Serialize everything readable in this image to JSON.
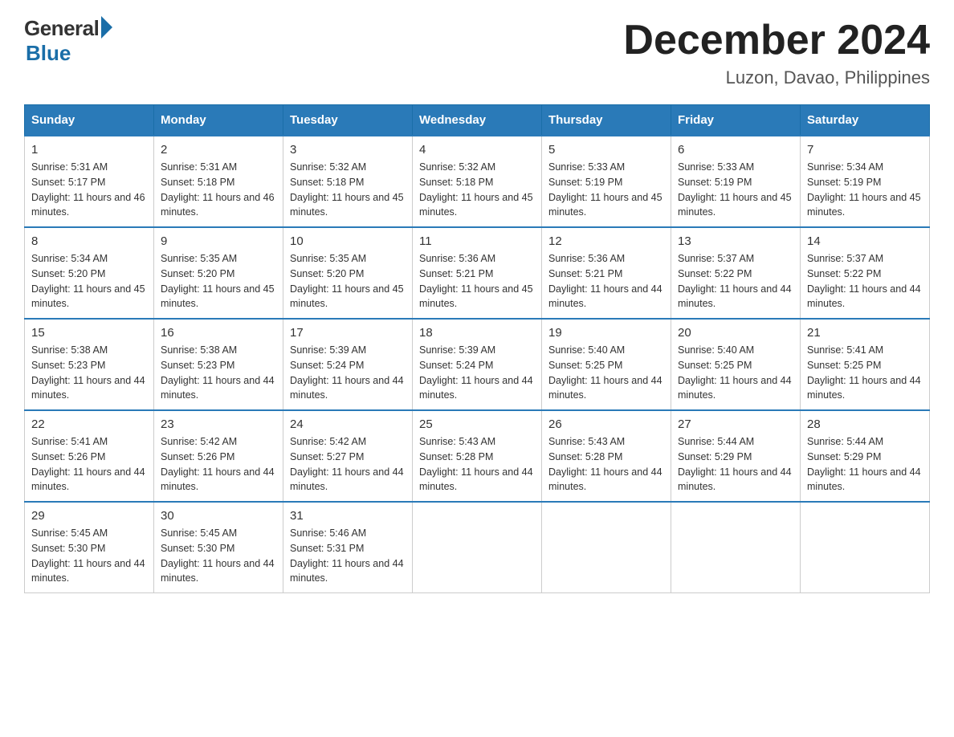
{
  "header": {
    "logo_general": "General",
    "logo_blue": "Blue",
    "main_title": "December 2024",
    "subtitle": "Luzon, Davao, Philippines"
  },
  "calendar": {
    "days_of_week": [
      "Sunday",
      "Monday",
      "Tuesday",
      "Wednesday",
      "Thursday",
      "Friday",
      "Saturday"
    ],
    "weeks": [
      [
        {
          "day": "1",
          "sunrise": "5:31 AM",
          "sunset": "5:17 PM",
          "daylight": "11 hours and 46 minutes."
        },
        {
          "day": "2",
          "sunrise": "5:31 AM",
          "sunset": "5:18 PM",
          "daylight": "11 hours and 46 minutes."
        },
        {
          "day": "3",
          "sunrise": "5:32 AM",
          "sunset": "5:18 PM",
          "daylight": "11 hours and 45 minutes."
        },
        {
          "day": "4",
          "sunrise": "5:32 AM",
          "sunset": "5:18 PM",
          "daylight": "11 hours and 45 minutes."
        },
        {
          "day": "5",
          "sunrise": "5:33 AM",
          "sunset": "5:19 PM",
          "daylight": "11 hours and 45 minutes."
        },
        {
          "day": "6",
          "sunrise": "5:33 AM",
          "sunset": "5:19 PM",
          "daylight": "11 hours and 45 minutes."
        },
        {
          "day": "7",
          "sunrise": "5:34 AM",
          "sunset": "5:19 PM",
          "daylight": "11 hours and 45 minutes."
        }
      ],
      [
        {
          "day": "8",
          "sunrise": "5:34 AM",
          "sunset": "5:20 PM",
          "daylight": "11 hours and 45 minutes."
        },
        {
          "day": "9",
          "sunrise": "5:35 AM",
          "sunset": "5:20 PM",
          "daylight": "11 hours and 45 minutes."
        },
        {
          "day": "10",
          "sunrise": "5:35 AM",
          "sunset": "5:20 PM",
          "daylight": "11 hours and 45 minutes."
        },
        {
          "day": "11",
          "sunrise": "5:36 AM",
          "sunset": "5:21 PM",
          "daylight": "11 hours and 45 minutes."
        },
        {
          "day": "12",
          "sunrise": "5:36 AM",
          "sunset": "5:21 PM",
          "daylight": "11 hours and 44 minutes."
        },
        {
          "day": "13",
          "sunrise": "5:37 AM",
          "sunset": "5:22 PM",
          "daylight": "11 hours and 44 minutes."
        },
        {
          "day": "14",
          "sunrise": "5:37 AM",
          "sunset": "5:22 PM",
          "daylight": "11 hours and 44 minutes."
        }
      ],
      [
        {
          "day": "15",
          "sunrise": "5:38 AM",
          "sunset": "5:23 PM",
          "daylight": "11 hours and 44 minutes."
        },
        {
          "day": "16",
          "sunrise": "5:38 AM",
          "sunset": "5:23 PM",
          "daylight": "11 hours and 44 minutes."
        },
        {
          "day": "17",
          "sunrise": "5:39 AM",
          "sunset": "5:24 PM",
          "daylight": "11 hours and 44 minutes."
        },
        {
          "day": "18",
          "sunrise": "5:39 AM",
          "sunset": "5:24 PM",
          "daylight": "11 hours and 44 minutes."
        },
        {
          "day": "19",
          "sunrise": "5:40 AM",
          "sunset": "5:25 PM",
          "daylight": "11 hours and 44 minutes."
        },
        {
          "day": "20",
          "sunrise": "5:40 AM",
          "sunset": "5:25 PM",
          "daylight": "11 hours and 44 minutes."
        },
        {
          "day": "21",
          "sunrise": "5:41 AM",
          "sunset": "5:25 PM",
          "daylight": "11 hours and 44 minutes."
        }
      ],
      [
        {
          "day": "22",
          "sunrise": "5:41 AM",
          "sunset": "5:26 PM",
          "daylight": "11 hours and 44 minutes."
        },
        {
          "day": "23",
          "sunrise": "5:42 AM",
          "sunset": "5:26 PM",
          "daylight": "11 hours and 44 minutes."
        },
        {
          "day": "24",
          "sunrise": "5:42 AM",
          "sunset": "5:27 PM",
          "daylight": "11 hours and 44 minutes."
        },
        {
          "day": "25",
          "sunrise": "5:43 AM",
          "sunset": "5:28 PM",
          "daylight": "11 hours and 44 minutes."
        },
        {
          "day": "26",
          "sunrise": "5:43 AM",
          "sunset": "5:28 PM",
          "daylight": "11 hours and 44 minutes."
        },
        {
          "day": "27",
          "sunrise": "5:44 AM",
          "sunset": "5:29 PM",
          "daylight": "11 hours and 44 minutes."
        },
        {
          "day": "28",
          "sunrise": "5:44 AM",
          "sunset": "5:29 PM",
          "daylight": "11 hours and 44 minutes."
        }
      ],
      [
        {
          "day": "29",
          "sunrise": "5:45 AM",
          "sunset": "5:30 PM",
          "daylight": "11 hours and 44 minutes."
        },
        {
          "day": "30",
          "sunrise": "5:45 AM",
          "sunset": "5:30 PM",
          "daylight": "11 hours and 44 minutes."
        },
        {
          "day": "31",
          "sunrise": "5:46 AM",
          "sunset": "5:31 PM",
          "daylight": "11 hours and 44 minutes."
        },
        null,
        null,
        null,
        null
      ]
    ]
  }
}
